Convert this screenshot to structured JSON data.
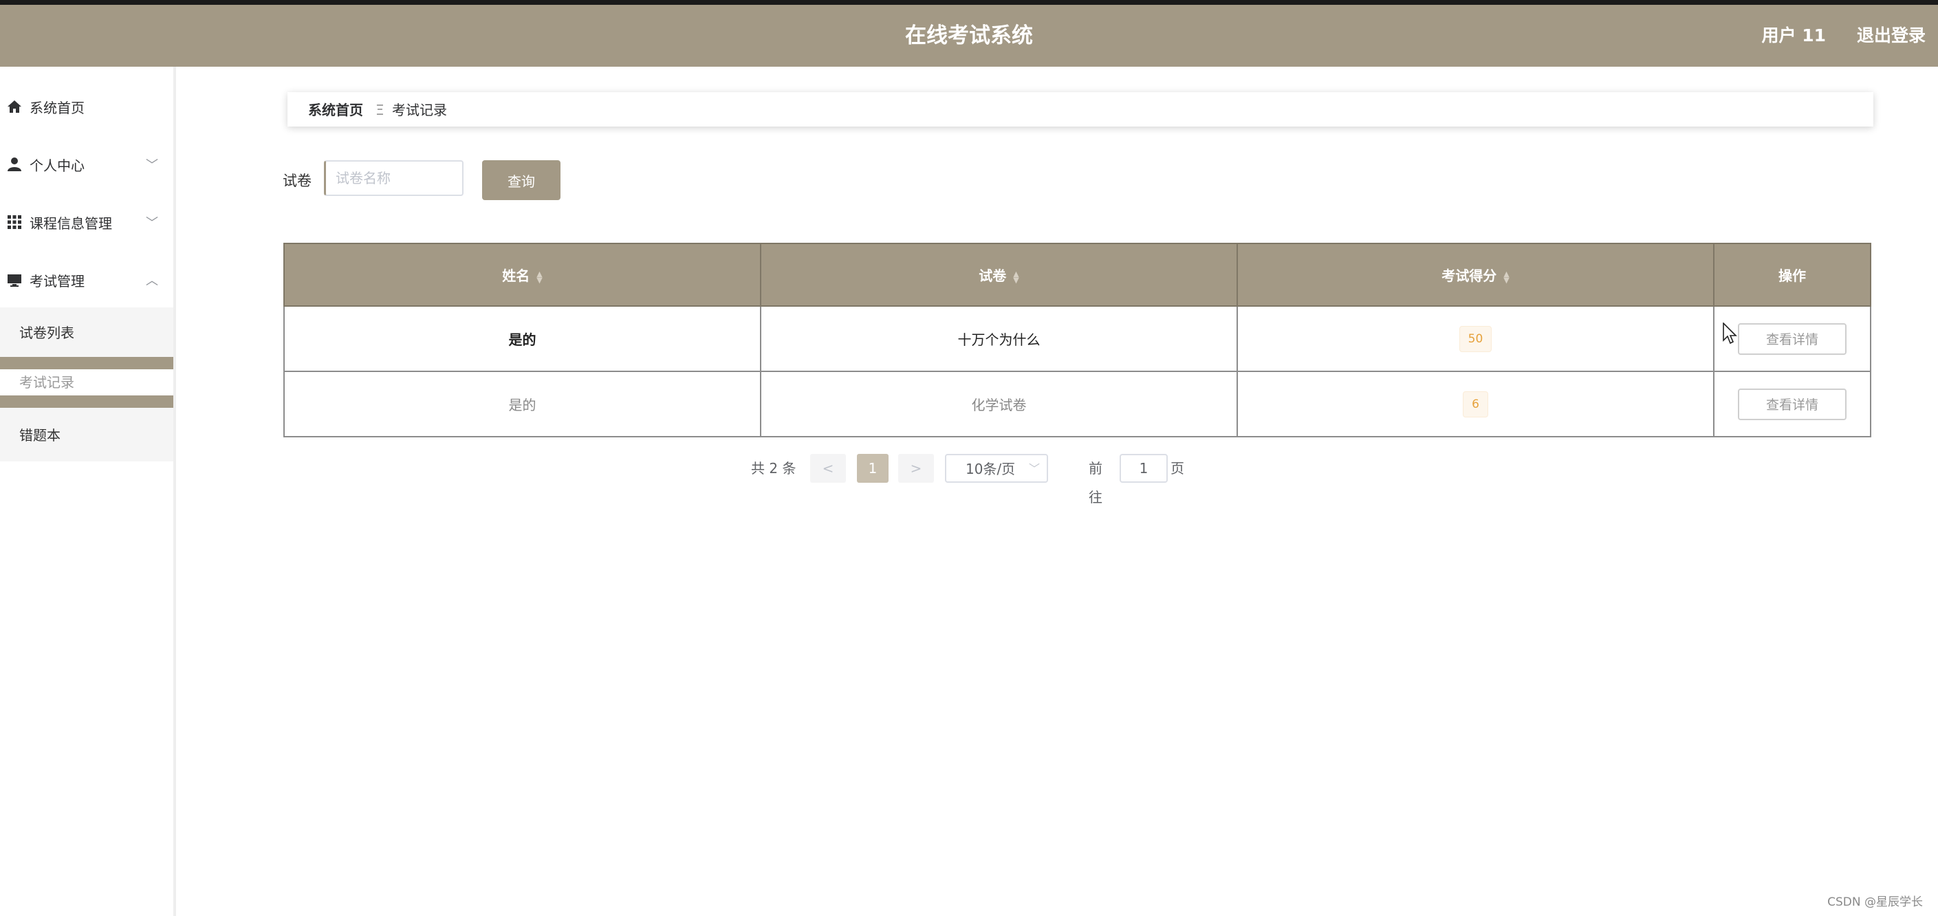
{
  "header": {
    "title": "在线考试系统",
    "user": "用户 11",
    "logout": "退出登录"
  },
  "sidebar": {
    "items": [
      {
        "label": "系统首页",
        "icon": "home-icon"
      },
      {
        "label": "个人中心",
        "icon": "user-icon",
        "chevron": "﹀"
      },
      {
        "label": "课程信息管理",
        "icon": "grid-icon",
        "chevron": "﹀"
      },
      {
        "label": "考试管理",
        "icon": "monitor-icon",
        "chevron": "︿"
      }
    ],
    "submenu": [
      "试卷列表",
      "考试记录",
      "错题本"
    ],
    "active_sub": "考试记录"
  },
  "breadcrumb": {
    "home": "系统首页",
    "separator": "Ξ",
    "current": "考试记录"
  },
  "search": {
    "label": "试卷",
    "placeholder": "试卷名称",
    "value": "",
    "button": "查询"
  },
  "table": {
    "headers": [
      "姓名",
      "试卷",
      "考试得分",
      "操作"
    ],
    "rows": [
      {
        "name": "是的",
        "paper": "十万个为什么",
        "score": "50",
        "action": "查看详情"
      },
      {
        "name": "是的",
        "paper": "化学试卷",
        "score": "6",
        "action": "查看详情"
      }
    ]
  },
  "pagination": {
    "total": "共 2 条",
    "prev": "<",
    "current": "1",
    "next": ">",
    "page_size": "10条/页",
    "goto_prefix": "前往",
    "goto_value": "1",
    "goto_suffix": "页"
  },
  "watermark": "CSDN @星辰学长",
  "colors": {
    "accent": "#a39985",
    "score_text": "#e6a23c"
  }
}
